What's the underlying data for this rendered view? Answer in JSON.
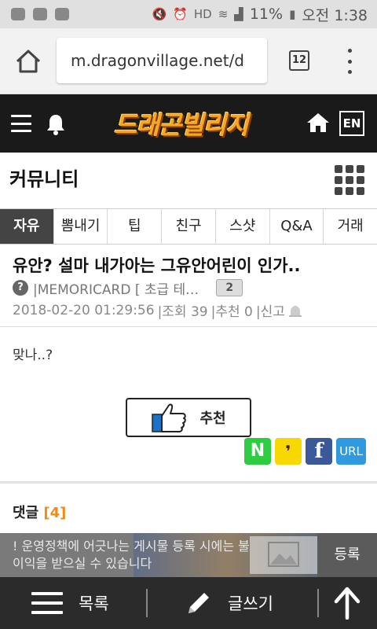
{
  "status_bar": {
    "battery_percent": "11%",
    "time": "오전 1:38",
    "hd_label": "HD"
  },
  "browser": {
    "url": "m.dragonvillage.net/d",
    "tab_count": "12"
  },
  "site_header": {
    "logo_text": "드래곤빌리지",
    "lang_button": "EN"
  },
  "community": {
    "title": "커뮤니티"
  },
  "tabs": [
    {
      "label": "자유",
      "active": true
    },
    {
      "label": "뽐내기",
      "active": false
    },
    {
      "label": "팁",
      "active": false
    },
    {
      "label": "친구",
      "active": false
    },
    {
      "label": "스샷",
      "active": false
    },
    {
      "label": "Q&A",
      "active": false
    },
    {
      "label": "거래",
      "active": false
    }
  ],
  "post": {
    "title": "유안? 설마 내가아는 그유안어린이 인가..",
    "author_badge": "?",
    "author": "|MEMORICARD [ 초급 테…",
    "level_badge": "2",
    "date": "2018-02-20 01:29:56",
    "views": "|조회 39",
    "recommend_count": "|추천 0",
    "report": "|신고",
    "body": "맞나..?",
    "recommend_label": "추천"
  },
  "share": {
    "naver": "N",
    "kakao": "❜",
    "facebook": "f",
    "url": "URL"
  },
  "comments": {
    "label": "댓글",
    "count": "[4]"
  },
  "notice": {
    "text": "! 운영정책에 어긋나는 게시물 등록 시에는 불이익을 받으실 수 있습니다",
    "register_label": "등록"
  },
  "bottom_bar": {
    "list_label": "목록",
    "write_label": "글쓰기"
  }
}
